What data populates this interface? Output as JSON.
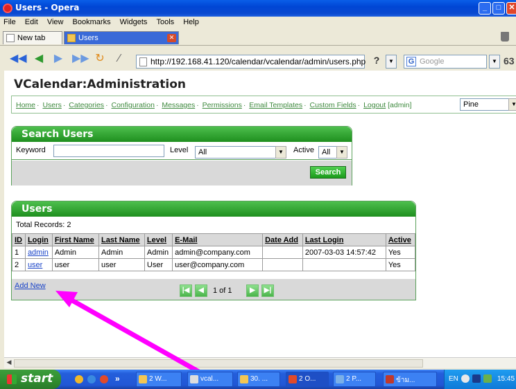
{
  "window": {
    "title": "Users - Opera"
  },
  "menu": [
    "File",
    "Edit",
    "View",
    "Bookmarks",
    "Widgets",
    "Tools",
    "Help"
  ],
  "tabs": [
    {
      "label": "New tab"
    },
    {
      "label": "Users"
    }
  ],
  "toolbar": {
    "address": "http://192.168.41.120/calendar/vcalendar/admin/users.php",
    "help_label": "?",
    "search_placeholder": "Google",
    "search_engine_icon": "G",
    "zoom_label": "63"
  },
  "page": {
    "title": "VCalendar:Administration",
    "nav_links": [
      "Home",
      "Users",
      "Categories",
      "Configuration",
      "Messages",
      "Permissions",
      "Email Templates",
      "Custom Fields",
      "Logout"
    ],
    "nav_user": "[admin]",
    "theme_value": "Pine",
    "search_panel": {
      "title": "Search Users",
      "keyword_label": "Keyword",
      "keyword_value": "",
      "level_label": "Level",
      "level_value": "All",
      "active_label": "Active",
      "active_value": "All",
      "search_button": "Search"
    },
    "users_panel": {
      "title": "Users",
      "total_label": "Total Records:",
      "total_value": "2",
      "columns": [
        "ID",
        "Login",
        "First Name",
        "Last Name",
        "Level",
        "E-Mail",
        "Date Add",
        "Last Login",
        "Active"
      ],
      "rows": [
        {
          "id": "1",
          "login": "admin",
          "first": "Admin",
          "last": "Admin",
          "level": "Admin",
          "email": "admin@company.com",
          "date_add": "",
          "last_login": "2007-03-03 14:57:42",
          "active": "Yes"
        },
        {
          "id": "2",
          "login": "user",
          "first": "user",
          "last": "user",
          "level": "User",
          "email": "user@company.com",
          "date_add": "",
          "last_login": "",
          "active": "Yes"
        }
      ],
      "add_new": "Add New",
      "pager_text": "1 of 1"
    }
  },
  "taskbar": {
    "start": "start",
    "quicklaunch_more": "»",
    "tasks": [
      "2 W...",
      "vcal...",
      "30. ...",
      "2 O...",
      "2 P...",
      "ข้าม..."
    ],
    "lang": "EN",
    "clock": "15:45"
  },
  "colors": {
    "accent_green": "#2a9a2a",
    "link_green": "#3f8a3f",
    "arrow": "#ff00ff"
  }
}
